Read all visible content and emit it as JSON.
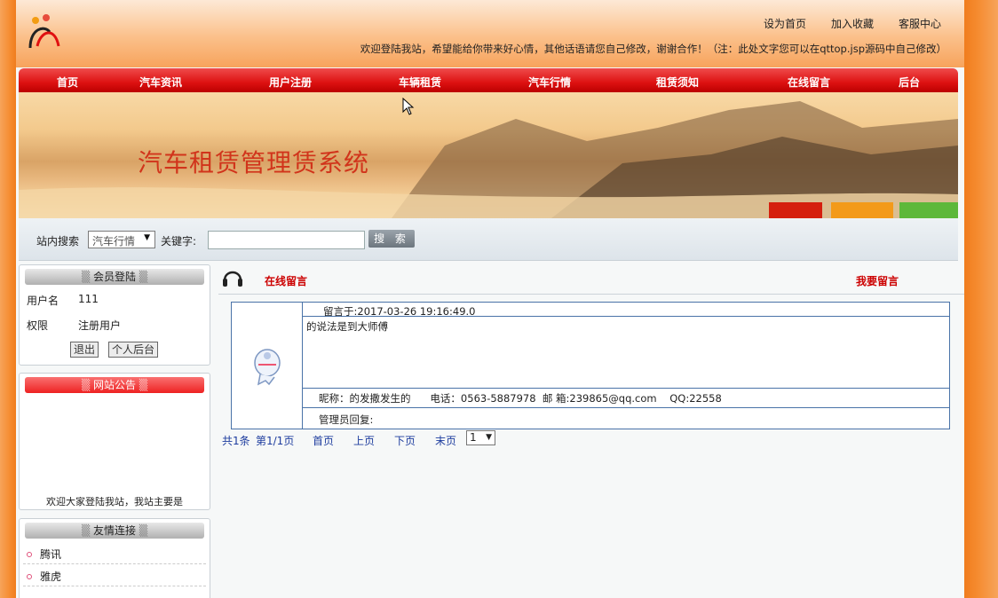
{
  "header": {
    "links": [
      "设为首页",
      "加入收藏",
      "客服中心"
    ],
    "welcome": "欢迎登陆我站，希望能给你带来好心情，其他话语请您自己修改，谢谢合作！（注：此处文字您可以在qttop.jsp源码中自己修改）"
  },
  "nav": [
    "首页",
    "汽车资讯",
    "用户注册",
    "车辆租赁",
    "汽车行情",
    "租赁须知",
    "在线留言",
    "后台"
  ],
  "banner": {
    "title": "汽车租赁管理赁系统"
  },
  "search": {
    "label": "站内搜索",
    "category": "汽车行情",
    "keyword_label": "关键字:",
    "keyword_value": "",
    "button": "搜 索"
  },
  "login": {
    "title": "会员登陆",
    "username_label": "用户名",
    "username": "111",
    "role_label": "权限",
    "role": "注册用户",
    "logout": "退出",
    "personal": "个人后台"
  },
  "notice": {
    "title": "网站公告",
    "text": "欢迎大家登陆我站，我站主要是"
  },
  "friends": {
    "title": "友情连接",
    "items": [
      "腾讯",
      "雅虎"
    ]
  },
  "main": {
    "title": "在线留言",
    "post_link": "我要留言",
    "message": {
      "time": "留言于:2017-03-26 19:16:49.0",
      "content": "的说法是到大师傅",
      "meta": "昵称：的发撒发生的      电话：0563-5887978  邮 箱:239865@qq.com    QQ:22558",
      "reply_label": "管理员回复:"
    },
    "pager": {
      "total": "共1条",
      "page": "第1/1页",
      "first": "首页",
      "prev": "上页",
      "next": "下页",
      "last": "末页",
      "current": "1"
    }
  },
  "colors": {
    "nav_red": "#d11111",
    "title_red": "#d1341b",
    "link_red": "#cc0000",
    "border_blue": "#4a73a8"
  }
}
